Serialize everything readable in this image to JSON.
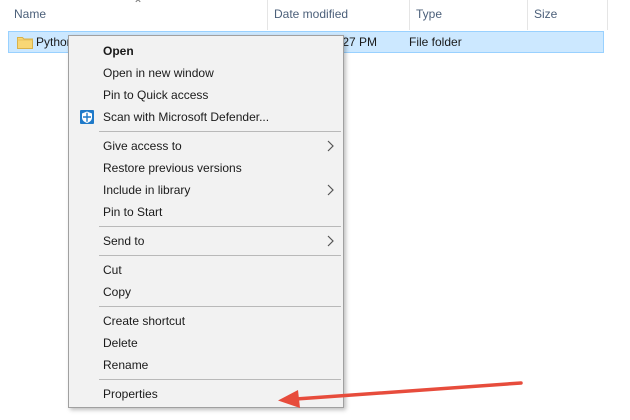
{
  "columns": {
    "name": "Name",
    "date_modified": "Date modified",
    "type": "Type",
    "size": "Size"
  },
  "file_row": {
    "name": "Python",
    "date_fragment": ":27 PM",
    "type": "File folder",
    "icon": "folder-icon"
  },
  "context_menu": {
    "items": [
      {
        "label": "Open"
      },
      {
        "label": "Open in new window"
      },
      {
        "label": "Pin to Quick access"
      },
      {
        "label": "Scan with Microsoft Defender...",
        "icon": "defender-shield-icon"
      },
      {
        "label": "Give access to",
        "submenu": true
      },
      {
        "label": "Restore previous versions"
      },
      {
        "label": "Include in library",
        "submenu": true
      },
      {
        "label": "Pin to Start"
      },
      {
        "label": "Send to",
        "submenu": true
      },
      {
        "label": "Cut"
      },
      {
        "label": "Copy"
      },
      {
        "label": "Create shortcut"
      },
      {
        "label": "Delete"
      },
      {
        "label": "Rename"
      },
      {
        "label": "Properties"
      }
    ]
  },
  "annotation": {
    "arrow_color": "#e74c3c",
    "points_to": "Properties"
  },
  "colors": {
    "selection_bg": "#cce8ff",
    "selection_border": "#99d1ff",
    "menu_bg": "#f2f2f2",
    "header_text": "#4c607a",
    "folder_yellow": "#f8d775"
  }
}
